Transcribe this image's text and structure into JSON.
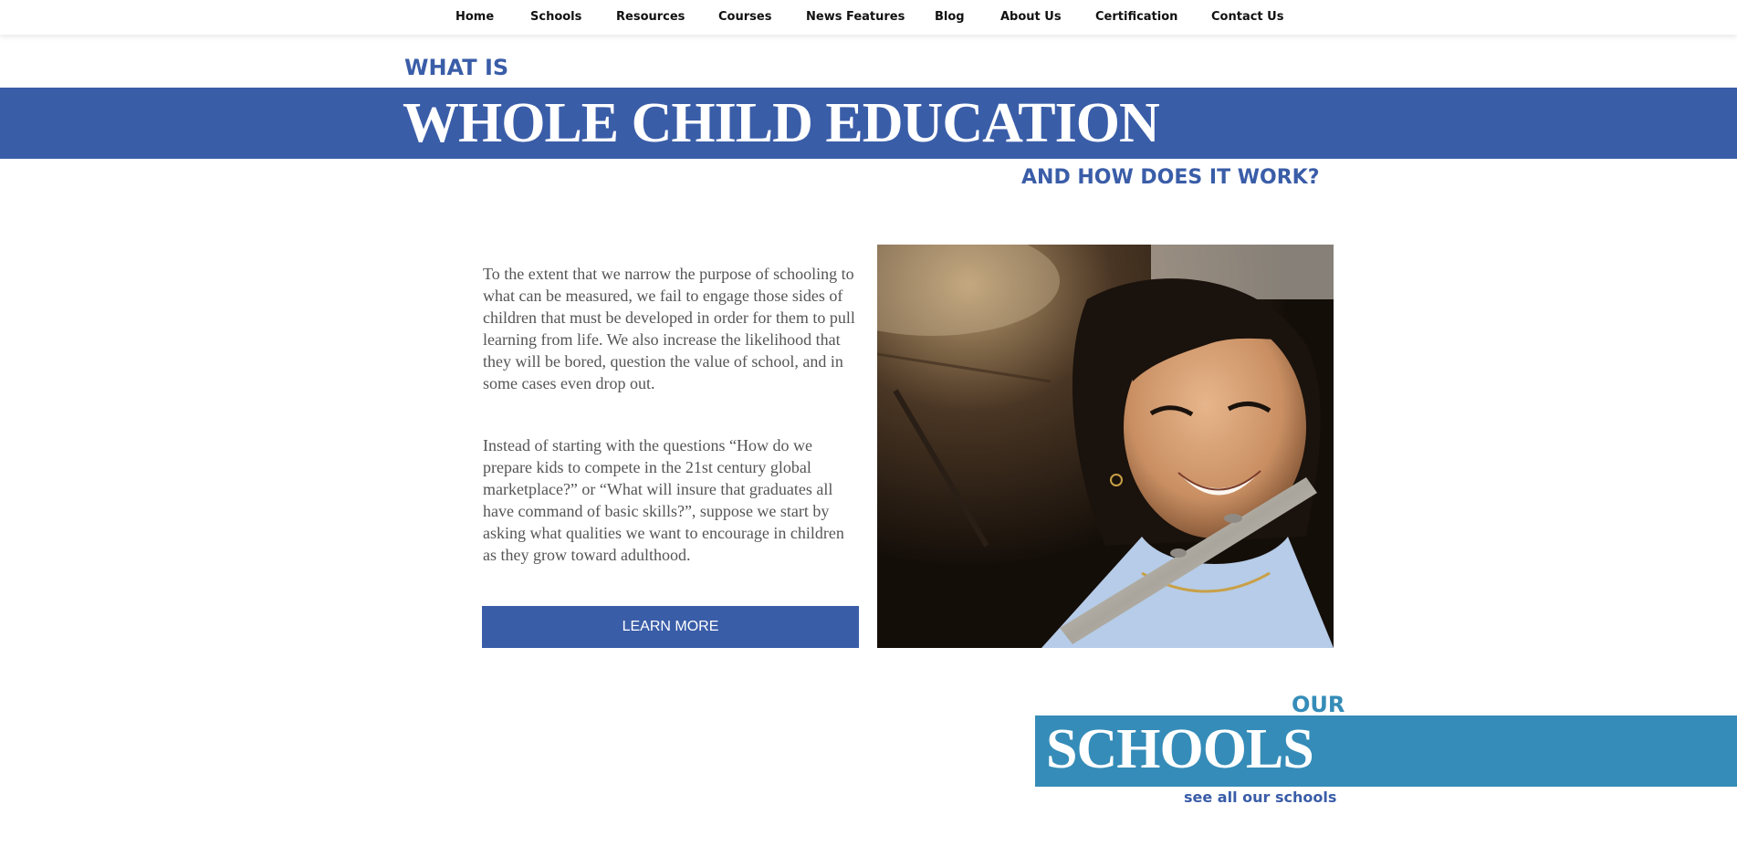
{
  "nav": {
    "items": [
      {
        "label": "Home"
      },
      {
        "label": "Schools"
      },
      {
        "label": "Resources"
      },
      {
        "label": "Courses"
      },
      {
        "label": "News Features"
      },
      {
        "label": "Blog"
      },
      {
        "label": "About Us"
      },
      {
        "label": "Certification"
      },
      {
        "label": "Contact Us"
      }
    ]
  },
  "hero": {
    "kicker": "WHAT IS",
    "title": "WHOLE CHILD EDUCATION",
    "subtitle": "AND HOW DOES IT WORK?",
    "band_color": "#3a5da8"
  },
  "intro": {
    "paragraph1": "To the extent that we narrow the purpose of schooling to what can be measured, we fail to engage those sides of children that must be developed in order for them to pull learning from life. We also increase the likelihood that they will be bored, question the value of school, and in some cases even drop out.",
    "paragraph2": "Instead of starting with the questions “How do we prepare kids to compete in the 21st century global marketplace?” or “What will insure that graduates all have command of basic skills?”, suppose we start by asking what qualities we want to encourage in children as they grow toward adulthood.",
    "button_label": "LEARN MORE",
    "button_color": "#3a5da8"
  },
  "schools": {
    "kicker": "OUR",
    "title": "SCHOOLS",
    "link_label": "see all our schools",
    "band_color": "#358cb8"
  }
}
